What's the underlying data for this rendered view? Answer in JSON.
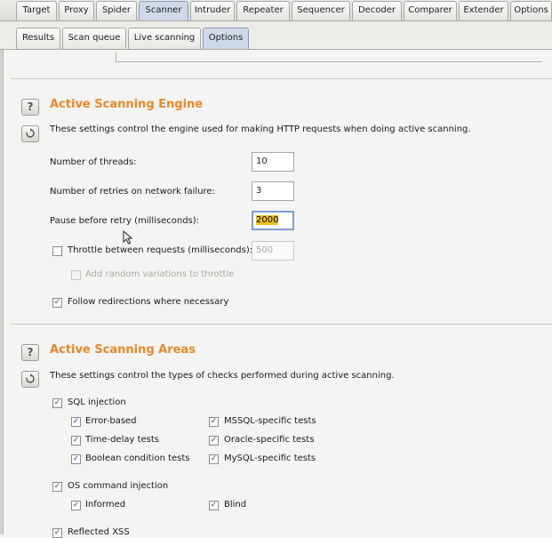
{
  "top_tabs": [
    {
      "label": "Target",
      "active": false
    },
    {
      "label": "Proxy",
      "active": false
    },
    {
      "label": "Spider",
      "active": false
    },
    {
      "label": "Scanner",
      "active": true
    },
    {
      "label": "Intruder",
      "active": false
    },
    {
      "label": "Repeater",
      "active": false
    },
    {
      "label": "Sequencer",
      "active": false
    },
    {
      "label": "Decoder",
      "active": false
    },
    {
      "label": "Comparer",
      "active": false
    },
    {
      "label": "Extender",
      "active": false
    },
    {
      "label": "Options",
      "active": false
    }
  ],
  "sub_tabs": [
    {
      "label": "Results",
      "active": false
    },
    {
      "label": "Scan queue",
      "active": false
    },
    {
      "label": "Live scanning",
      "active": false
    },
    {
      "label": "Options",
      "active": true
    }
  ],
  "engine": {
    "help_icon": "?",
    "title": "Active Scanning Engine",
    "description": "These settings control the engine used for making HTTP requests when doing active scanning.",
    "threads_label": "Number of threads:",
    "threads_value": "10",
    "retries_label": "Number of retries on network failure:",
    "retries_value": "3",
    "pause_label": "Pause before retry (milliseconds):",
    "pause_value_sel": "2",
    "pause_value_rest": "000",
    "throttle_label": "Throttle between requests (milliseconds):",
    "throttle_value": "500",
    "throttle_checked": false,
    "random_label": "Add random variations to throttle",
    "random_checked": false,
    "follow_label": "Follow redirections where necessary",
    "follow_checked": true
  },
  "areas": {
    "help_icon": "?",
    "title": "Active Scanning Areas",
    "description": "These settings control the types of checks performed during active scanning.",
    "sql_label": "SQL injection",
    "sql_checked": true,
    "error_label": "Error-based",
    "time_label": "Time-delay tests",
    "bool_label": "Boolean condition tests",
    "mssql_label": "MSSQL-specific tests",
    "oracle_label": "Oracle-specific tests",
    "mysql_label": "MySQL-specific tests",
    "os_label": "OS command injection",
    "informed_label": "Informed",
    "blind_label": "Blind",
    "reflected_label": "Reflected XSS"
  },
  "checkmark": "✓",
  "colors": {
    "section_title": "#e8882a",
    "active_tab": "#cfd9e8",
    "selection": "#f0c020"
  }
}
